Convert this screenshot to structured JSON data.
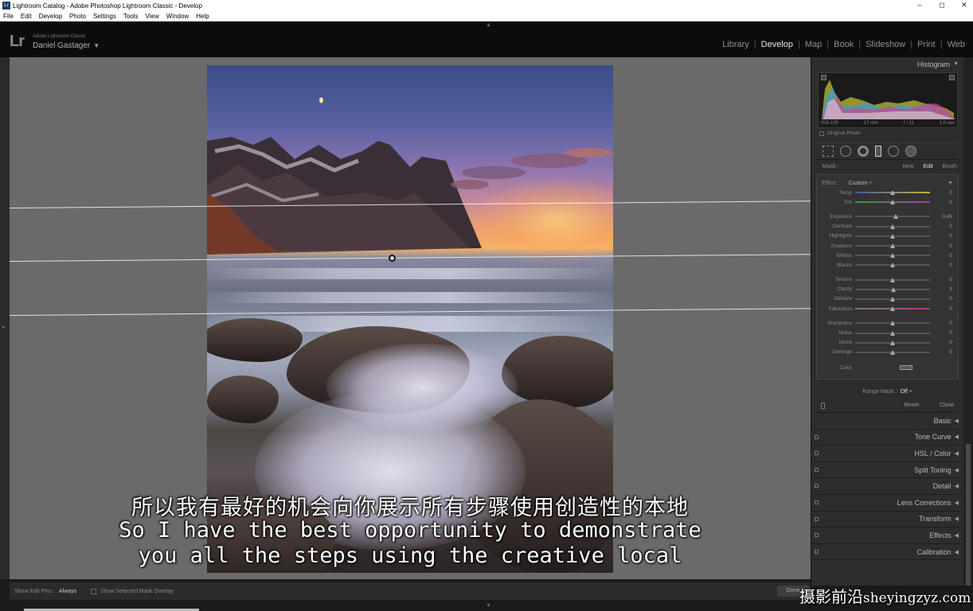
{
  "window": {
    "title": "Lightroom Catalog - Adobe Photoshop Lightroom Classic - Develop",
    "app_icon": "Lr",
    "controls": [
      "–",
      "◻",
      "✕"
    ]
  },
  "menu": [
    "File",
    "Edit",
    "Develop",
    "Photo",
    "Settings",
    "Tools",
    "View",
    "Window",
    "Help"
  ],
  "identity": {
    "logo": "Lr",
    "product": "Adobe Lightroom Classic",
    "user": "Daniel Gastager",
    "user_caret": "▼"
  },
  "modules": [
    {
      "label": "Library",
      "active": false
    },
    {
      "label": "Develop",
      "active": true
    },
    {
      "label": "Map",
      "active": false
    },
    {
      "label": "Book",
      "active": false
    },
    {
      "label": "Slideshow",
      "active": false
    },
    {
      "label": "Print",
      "active": false
    },
    {
      "label": "Web",
      "active": false
    }
  ],
  "subtitles": {
    "cn": "所以我有最好的机会向你展示所有步骤使用创造性的本地",
    "en_line1": "So I have the best opportunity to demonstrate",
    "en_line2": "you all the steps using the creative local"
  },
  "toolbar": {
    "edit_pins_label": "Show Edit Pins :",
    "edit_pins_value": "Always",
    "mask_overlay_label": "Show Selected Mask Overlay",
    "done_label": "Done"
  },
  "histogram": {
    "title": "Histogram",
    "iso": "ISO 100",
    "focal": "17 mm",
    "aperture": "f / 11",
    "shutter": "1,0 sec",
    "original_photo": "Original Photo"
  },
  "mask": {
    "label": "Mask :",
    "new": "New",
    "edit": "Edit",
    "brush": "Brush"
  },
  "effect": {
    "label": "Effect :",
    "value": "Custom ÷"
  },
  "sliders": [
    {
      "label": "Temp",
      "value": "0",
      "pos": 0.5,
      "group": 1
    },
    {
      "label": "Tint",
      "value": "0",
      "pos": 0.5,
      "group": 1
    },
    {
      "label": "Exposure",
      "value": "0,49",
      "pos": 0.54,
      "group": 2
    },
    {
      "label": "Contrast",
      "value": "0",
      "pos": 0.5,
      "group": 2
    },
    {
      "label": "Highlights",
      "value": "0",
      "pos": 0.5,
      "group": 2
    },
    {
      "label": "Shadows",
      "value": "0",
      "pos": 0.5,
      "group": 2
    },
    {
      "label": "Whites",
      "value": "0",
      "pos": 0.5,
      "group": 2
    },
    {
      "label": "Blacks",
      "value": "0",
      "pos": 0.5,
      "group": 2
    },
    {
      "label": "Texture",
      "value": "0",
      "pos": 0.5,
      "group": 3
    },
    {
      "label": "Clarity",
      "value": "3",
      "pos": 0.515,
      "group": 3
    },
    {
      "label": "Dehaze",
      "value": "0",
      "pos": 0.5,
      "group": 3
    },
    {
      "label": "Saturation",
      "value": "0",
      "pos": 0.5,
      "group": 3
    },
    {
      "label": "Sharpness",
      "value": "0",
      "pos": 0.5,
      "group": 4
    },
    {
      "label": "Noise",
      "value": "0",
      "pos": 0.5,
      "group": 4
    },
    {
      "label": "Moiré",
      "value": "0",
      "pos": 0.5,
      "group": 4
    },
    {
      "label": "Defringe",
      "value": "0",
      "pos": 0.5,
      "group": 4
    }
  ],
  "color_label": "Color",
  "range_mask": {
    "label": "Range Mask :",
    "value": "Off ÷"
  },
  "reset_label": "Reset",
  "close_label": "Close",
  "sections": [
    "Basic",
    "Tone Curve",
    "HSL / Color",
    "Split Toning",
    "Detail",
    "Lens Corrections",
    "Transform",
    "Effects",
    "Calibration"
  ],
  "watermark": {
    "cn": "摄影前沿",
    "latin": "sheyingzyz.com"
  },
  "colors": {
    "accent_active": "#e6e6e6",
    "panel_bg": "#2d2d2d",
    "canvas_bg": "#6a6a6a"
  }
}
